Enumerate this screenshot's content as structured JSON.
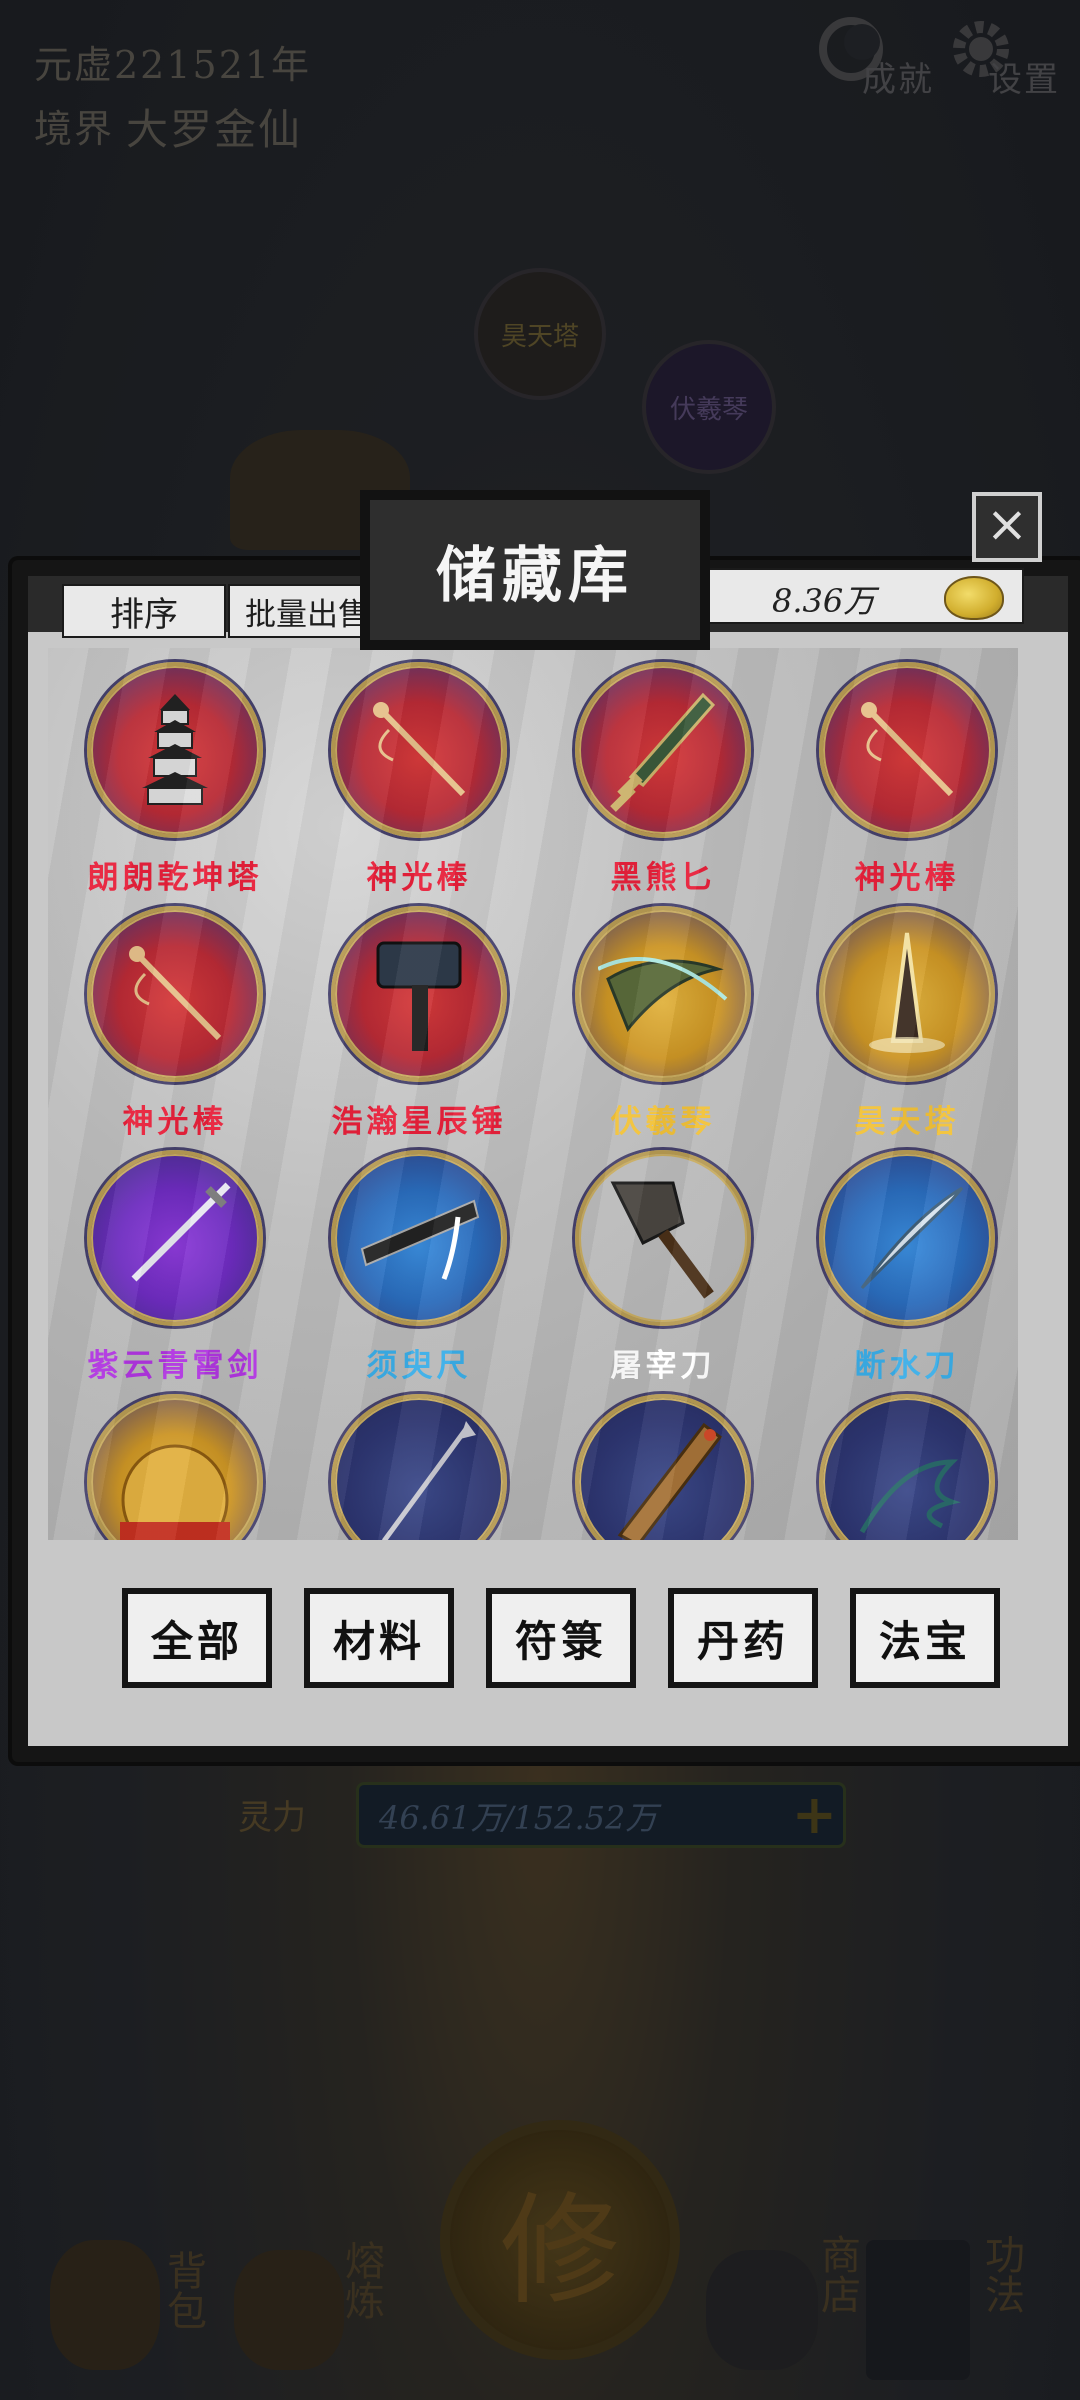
{
  "hud": {
    "year": "元虚221521年",
    "realm_label": "境界",
    "realm_value": "大罗金仙",
    "achievements": "成就",
    "settings": "设置"
  },
  "scene": {
    "orb1": "昊天塔",
    "orb2": "伏羲琴",
    "mana_label": "灵力",
    "mana_value": "46.61万/152.52万",
    "center_seal": "修"
  },
  "storage": {
    "title": "储藏库",
    "sort_label": "排序",
    "batch_sell_label": "批量出售",
    "currency": "8.36万",
    "close_icon": "close-icon",
    "items": [
      {
        "name": "朗朗乾坤塔",
        "rarity": "red",
        "icon": "pagoda"
      },
      {
        "name": "神光棒",
        "rarity": "red",
        "icon": "staff"
      },
      {
        "name": "黑熊匕",
        "rarity": "red",
        "icon": "dagger"
      },
      {
        "name": "神光棒",
        "rarity": "red",
        "icon": "staff"
      },
      {
        "name": "神光棒",
        "rarity": "red",
        "icon": "staff"
      },
      {
        "name": "浩瀚星辰锤",
        "rarity": "red",
        "icon": "hammer"
      },
      {
        "name": "伏羲琴",
        "rarity": "gold",
        "icon": "zither"
      },
      {
        "name": "昊天塔",
        "rarity": "gold",
        "icon": "tower"
      },
      {
        "name": "紫云青霄剑",
        "rarity": "purple",
        "icon": "sword"
      },
      {
        "name": "须臾尺",
        "rarity": "blue",
        "icon": "ruler"
      },
      {
        "name": "屠宰刀",
        "rarity": "white",
        "icon": "cleaver"
      },
      {
        "name": "断水刀",
        "rarity": "blue",
        "icon": "saber"
      },
      {
        "name": "",
        "rarity": "gold",
        "icon": "helmet"
      },
      {
        "name": "",
        "rarity": "navy",
        "icon": "spear"
      },
      {
        "name": "",
        "rarity": "navy",
        "icon": "scabbard"
      },
      {
        "name": "",
        "rarity": "navy",
        "icon": "whip"
      }
    ],
    "filters": [
      "全部",
      "材料",
      "符箓",
      "丹药",
      "法宝"
    ]
  },
  "bottom_nav": {
    "bag": "背包",
    "refine": "熔炼",
    "shop": "商店",
    "skills": "功法"
  },
  "colors": {
    "red": "#e8203a",
    "gold": "#f2c238",
    "purple": "#b035e0",
    "blue": "#3aaee8",
    "white": "#ffffff"
  }
}
